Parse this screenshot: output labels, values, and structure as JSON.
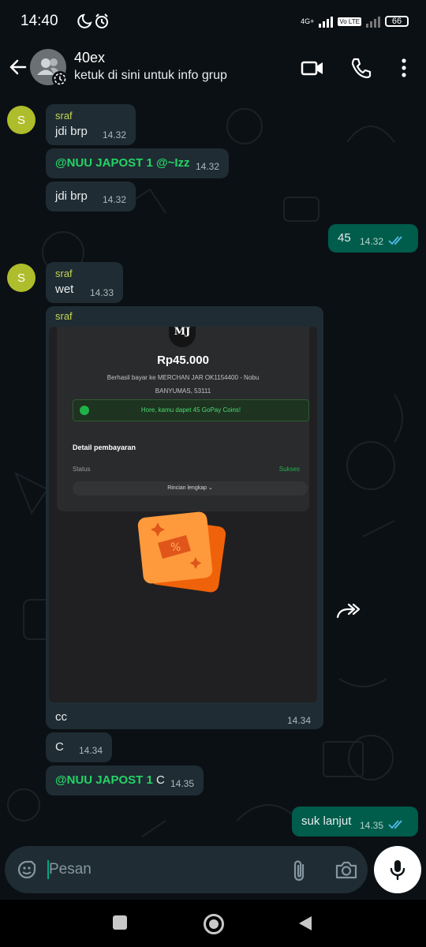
{
  "status_bar": {
    "time": "14:40",
    "network": "4G+",
    "volte": "Vo LTE",
    "battery": "66"
  },
  "header": {
    "group_name": "40ex",
    "subtitle": "ketuk di sini untuk info grup"
  },
  "messages": [
    {
      "sender": "sraf",
      "avatar_letter": "S",
      "text": "jdi brp",
      "time": "14.32"
    },
    {
      "mention": "@NUU JAPOST 1 @~Izz",
      "time": "14.32"
    },
    {
      "text": "jdi brp",
      "time": "14.32"
    },
    {
      "text": "45",
      "time": "14.32"
    },
    {
      "sender": "sraf",
      "avatar_letter": "S",
      "text": "wet",
      "time": "14.33"
    },
    {
      "sender": "sraf",
      "caption": "cc",
      "time": "14.34"
    },
    {
      "text": "C",
      "time": "14.34"
    },
    {
      "mention": "@NUU JAPOST 1",
      "text": " C",
      "time": "14.35"
    },
    {
      "text": "suk lanjut",
      "time": "14.35"
    }
  ],
  "receipt": {
    "logo": "MJ",
    "amount": "Rp45.000",
    "desc_line1": "Berhasil bayar ke MERCHAN JAR OK1154400 - Nobu",
    "desc_line2": "BANYUMAS, 53111",
    "coins_text": "Hore, kamu dapet 45 GoPay Coins!",
    "detail_title": "Detail pembayaran",
    "status_label": "Status",
    "status_value": "Sukses",
    "rincian": "Rincian lengkap ⌄"
  },
  "input": {
    "placeholder": "Pesan"
  },
  "colors": {
    "background": "#0b1014",
    "incoming_bubble": "#1f2c33",
    "outgoing_bubble": "#005c4b",
    "sender_name": "#c7d64f",
    "mention": "#25d366",
    "read_ticks": "#53bdeb",
    "avatar": "#aebd2b"
  },
  "icons": [
    "moon-icon",
    "alarm-icon",
    "back-arrow-icon",
    "group-icon",
    "video-call-icon",
    "phone-icon",
    "more-vert-icon",
    "read-ticks-icon",
    "forward-icon",
    "sticker-icon",
    "attach-icon",
    "camera-icon",
    "mic-icon",
    "nav-recents-icon",
    "nav-home-icon",
    "nav-back-icon"
  ]
}
